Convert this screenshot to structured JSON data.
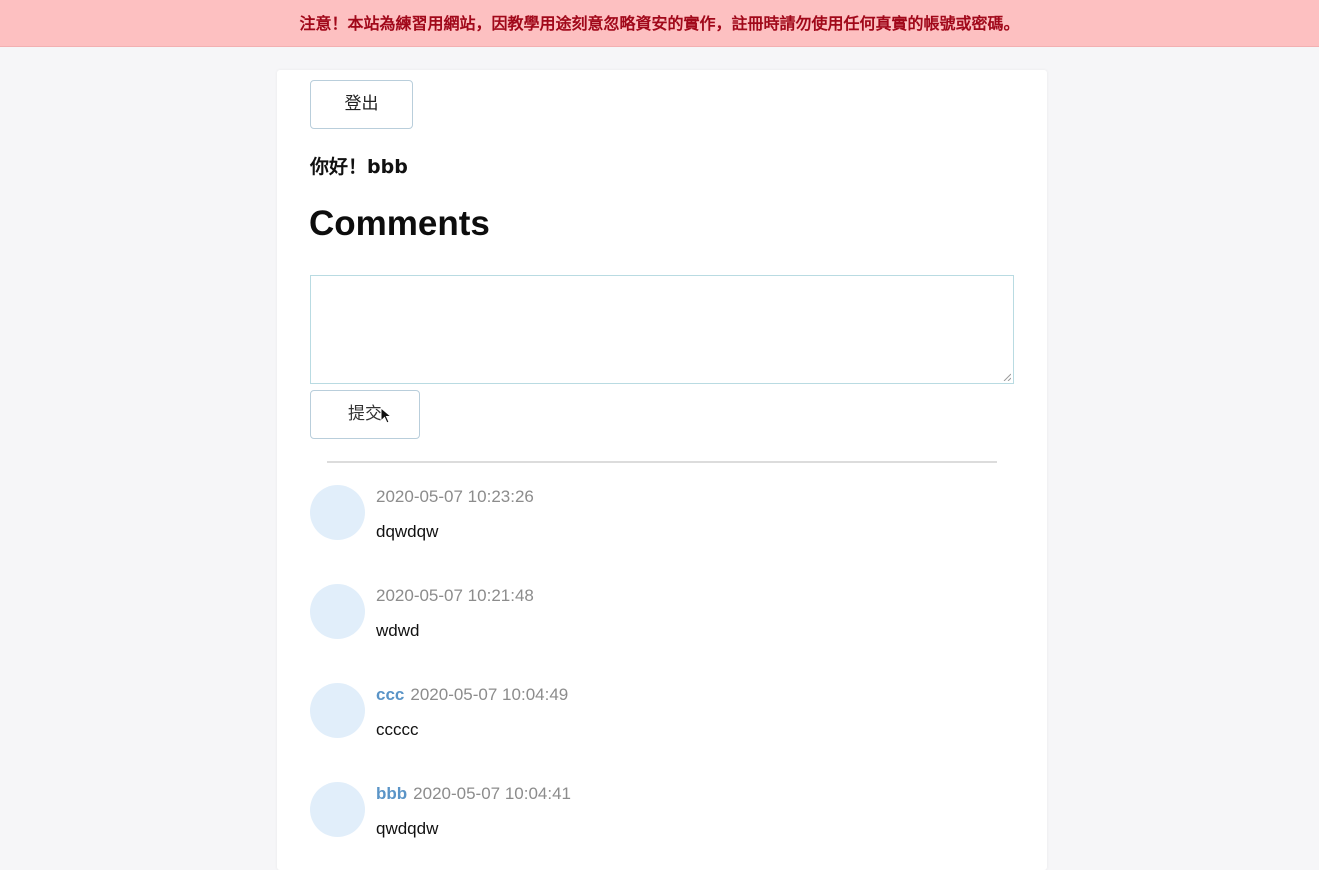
{
  "warning": {
    "text": "注意！本站為練習用網站，因教學用途刻意忽略資安的實作，註冊時請勿使用任何真實的帳號或密碼。",
    "color": "#a1081a",
    "background": "#fdc0c1"
  },
  "header": {
    "logout_label": "登出",
    "greeting": "你好！bbb"
  },
  "main": {
    "title": "Comments",
    "comment_input": {
      "value": "",
      "placeholder": ""
    },
    "submit_label": "提交"
  },
  "comments": [
    {
      "author": "",
      "time": "2020-05-07 10:23:26",
      "content": "dqwdqw"
    },
    {
      "author": "",
      "time": "2020-05-07 10:21:48",
      "content": "wdwd"
    },
    {
      "author": "ccc",
      "time": "2020-05-07 10:04:49",
      "content": "ccccc"
    },
    {
      "author": "bbb",
      "time": "2020-05-07 10:04:41",
      "content": "qwdqdw"
    }
  ],
  "colors": {
    "author": "#5a94c7",
    "avatar": "#e1eefa",
    "time": "#8c8c8c"
  },
  "icons": {
    "cursor": "mouse-pointer-icon",
    "resize": "resize-grip-icon"
  }
}
